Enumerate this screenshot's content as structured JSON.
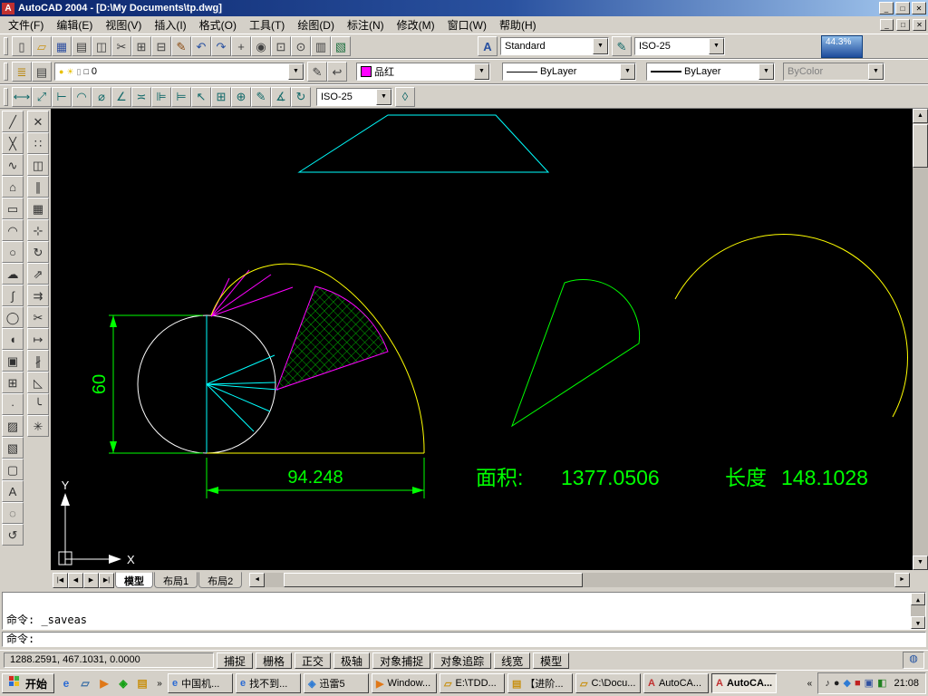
{
  "title_bar": {
    "icon": "A",
    "title": "AutoCAD 2004 - [D:\\My Documents\\tp.dwg]",
    "buttons": {
      "minimize": "_",
      "maximize": "□",
      "close": "✕"
    }
  },
  "menu_bar": {
    "items": [
      {
        "n": "menu-file",
        "label": "文件(F)"
      },
      {
        "n": "menu-edit",
        "label": "编辑(E)"
      },
      {
        "n": "menu-view",
        "label": "视图(V)"
      },
      {
        "n": "menu-insert",
        "label": "插入(I)"
      },
      {
        "n": "menu-format",
        "label": "格式(O)"
      },
      {
        "n": "menu-tools",
        "label": "工具(T)"
      },
      {
        "n": "menu-draw",
        "label": "绘图(D)"
      },
      {
        "n": "menu-dimension",
        "label": "标注(N)"
      },
      {
        "n": "menu-modify",
        "label": "修改(M)"
      },
      {
        "n": "menu-window",
        "label": "窗口(W)"
      },
      {
        "n": "menu-help",
        "label": "帮助(H)"
      }
    ],
    "mdi": {
      "minimize": "_",
      "restore": "□",
      "close": "✕"
    }
  },
  "toolbar_standard": {
    "icons": [
      {
        "n": "new-icon",
        "g": "▯",
        "c": "#404040"
      },
      {
        "n": "open-icon",
        "g": "▱",
        "c": "#C89010"
      },
      {
        "n": "save-icon",
        "g": "▦",
        "c": "#3050A0"
      },
      {
        "n": "plot-icon",
        "g": "▤",
        "c": "#404040"
      },
      {
        "n": "plot-preview-icon",
        "g": "◫",
        "c": "#404040"
      },
      {
        "n": "cut-icon",
        "g": "✂",
        "c": "#404040"
      },
      {
        "n": "copy-icon",
        "g": "⊞",
        "c": "#404040"
      },
      {
        "n": "paste-icon",
        "g": "⊟",
        "c": "#404040"
      },
      {
        "n": "match-properties-icon",
        "g": "✎",
        "c": "#8A4A10"
      },
      {
        "n": "undo-icon",
        "g": "↶",
        "c": "#2850A0"
      },
      {
        "n": "redo-icon",
        "g": "↷",
        "c": "#2850A0"
      },
      {
        "n": "pan-icon",
        "g": "+",
        "c": "#404040"
      },
      {
        "n": "zoom-realtime-icon",
        "g": "◉",
        "c": "#404040"
      },
      {
        "n": "zoom-window-icon",
        "g": "⊡",
        "c": "#404040"
      },
      {
        "n": "zoom-previous-icon",
        "g": "⊙",
        "c": "#404040"
      },
      {
        "n": "properties-icon",
        "g": "▥",
        "c": "#404040"
      },
      {
        "n": "designcenter-icon",
        "g": "▧",
        "c": "#207040"
      }
    ],
    "text_style_icon": "A",
    "text_style": "Standard",
    "dim_style_icon": "✎",
    "dim_style": "ISO-25",
    "zoom_badge": "44.3%"
  },
  "toolbar_layers": {
    "manager_icon": "≣",
    "states_icon": "▤",
    "layer_icons": [
      {
        "n": "layer-on-icon",
        "g": "●",
        "c": "#E8C000"
      },
      {
        "n": "layer-freeze-icon",
        "g": "☀",
        "c": "#E8C000"
      },
      {
        "n": "layer-lock-icon",
        "g": "▯",
        "c": "#808080"
      },
      {
        "n": "layer-color-icon",
        "g": "□",
        "c": "#000000"
      }
    ],
    "current_layer": "0",
    "make_current_icon": "✎",
    "previous_icon": "↩",
    "color_value": "品红",
    "color_hex": "#FF00FF",
    "linetype_value": "ByLayer",
    "lineweight_value": "ByLayer",
    "plotstyle_value": "ByColor"
  },
  "toolbar_dimension": {
    "icons": [
      {
        "n": "linear-dimension-icon",
        "g": "⟷",
        "c": "#106868"
      },
      {
        "n": "aligned-dimension-icon",
        "g": "⤢",
        "c": "#106868"
      },
      {
        "n": "ordinate-dimension-icon",
        "g": "⊢",
        "c": "#106868"
      },
      {
        "n": "radius-dimension-icon",
        "g": "◠",
        "c": "#106868"
      },
      {
        "n": "diameter-dimension-icon",
        "g": "⌀",
        "c": "#106868"
      },
      {
        "n": "angular-dimension-icon",
        "g": "∠",
        "c": "#106868"
      },
      {
        "n": "quick-dimension-icon",
        "g": "≍",
        "c": "#106868"
      },
      {
        "n": "baseline-dimension-icon",
        "g": "⊫",
        "c": "#106868"
      },
      {
        "n": "continue-dimension-icon",
        "g": "⊨",
        "c": "#106868"
      },
      {
        "n": "quick-leader-icon",
        "g": "↖",
        "c": "#106868"
      },
      {
        "n": "tolerance-icon",
        "g": "⊞",
        "c": "#106868"
      },
      {
        "n": "center-mark-icon",
        "g": "⊕",
        "c": "#106868"
      },
      {
        "n": "dimension-edit-icon",
        "g": "✎",
        "c": "#106868"
      },
      {
        "n": "dimension-text-edit-icon",
        "g": "∡",
        "c": "#106868"
      },
      {
        "n": "dimension-update-icon",
        "g": "↻",
        "c": "#106868"
      }
    ],
    "dim_style": "ISO-25",
    "style_icon": "◊"
  },
  "toolbar_draw": {
    "icons": [
      {
        "n": "line-icon",
        "g": "╱",
        "c": "#303030"
      },
      {
        "n": "construction-line-icon",
        "g": "╳",
        "c": "#303030"
      },
      {
        "n": "polyline-icon",
        "g": "∿",
        "c": "#303030"
      },
      {
        "n": "polygon-icon",
        "g": "⌂",
        "c": "#303030"
      },
      {
        "n": "rectangle-icon",
        "g": "▭",
        "c": "#303030"
      },
      {
        "n": "arc-icon",
        "g": "◠",
        "c": "#303030"
      },
      {
        "n": "circle-icon",
        "g": "○",
        "c": "#303030"
      },
      {
        "n": "revision-cloud-icon",
        "g": "☁",
        "c": "#303030"
      },
      {
        "n": "spline-icon",
        "g": "∫",
        "c": "#303030"
      },
      {
        "n": "ellipse-icon",
        "g": "◯",
        "c": "#303030"
      },
      {
        "n": "ellipse-arc-icon",
        "g": "◖",
        "c": "#303030"
      },
      {
        "n": "insert-block-icon",
        "g": "▣",
        "c": "#303030"
      },
      {
        "n": "make-block-icon",
        "g": "⊞",
        "c": "#303030"
      },
      {
        "n": "point-icon",
        "g": "∙",
        "c": "#303030"
      },
      {
        "n": "hatch-icon",
        "g": "▨",
        "c": "#303030"
      },
      {
        "n": "gradient-icon",
        "g": "▧",
        "c": "#303030"
      },
      {
        "n": "region-icon",
        "g": "▢",
        "c": "#303030"
      },
      {
        "n": "multiline-text-icon",
        "g": "A",
        "c": "#303030"
      },
      {
        "n": "draw-extra-1-icon",
        "g": "◌",
        "c": "#303030"
      },
      {
        "n": "draw-extra-2-icon",
        "g": "↺",
        "c": "#303030"
      }
    ]
  },
  "toolbar_modify": {
    "icons": [
      {
        "n": "erase-icon",
        "g": "✕",
        "c": "#303030"
      },
      {
        "n": "copy-object-icon",
        "g": "∷",
        "c": "#303030"
      },
      {
        "n": "mirror-icon",
        "g": "◫",
        "c": "#303030"
      },
      {
        "n": "offset-icon",
        "g": "∥",
        "c": "#303030"
      },
      {
        "n": "array-icon",
        "g": "▦",
        "c": "#303030"
      },
      {
        "n": "move-icon",
        "g": "⊹",
        "c": "#303030"
      },
      {
        "n": "rotate-icon",
        "g": "↻",
        "c": "#303030"
      },
      {
        "n": "scale-icon",
        "g": "⇗",
        "c": "#303030"
      },
      {
        "n": "stretch-icon",
        "g": "⇉",
        "c": "#303030"
      },
      {
        "n": "trim-icon",
        "g": "✂",
        "c": "#303030"
      },
      {
        "n": "extend-icon",
        "g": "↦",
        "c": "#303030"
      },
      {
        "n": "break-icon",
        "g": "∦",
        "c": "#303030"
      },
      {
        "n": "chamfer-icon",
        "g": "◺",
        "c": "#303030"
      },
      {
        "n": "fillet-icon",
        "g": "╰",
        "c": "#303030"
      },
      {
        "n": "explode-icon",
        "g": "✳",
        "c": "#303030"
      }
    ]
  },
  "drawing": {
    "dim_vertical": "60",
    "dim_horizontal": "94.248",
    "area_label": "面积:",
    "area_value": "1377.0506",
    "length_label": "长度",
    "length_value": "148.1028",
    "axis_x": "X",
    "axis_y": "Y",
    "colors": {
      "dimension": "#00FF00",
      "outline": "#FFFF00",
      "construction": "#00FFFF",
      "fan": "#FF00FF",
      "hatch": "#00B000",
      "entity": "#FFFFFF"
    }
  },
  "tabs": {
    "items": [
      {
        "n": "tab-model",
        "label": "模型",
        "active": true
      },
      {
        "n": "tab-layout1",
        "label": "布局1"
      },
      {
        "n": "tab-layout2",
        "label": "布局2"
      }
    ]
  },
  "command": {
    "history": [
      {
        "line": "命令: _saveas"
      }
    ],
    "prompt": "命令:"
  },
  "status_bar": {
    "coords": "1288.2591, 467.1031, 0.0000",
    "toggles": [
      {
        "n": "toggle-snap",
        "label": "捕捉"
      },
      {
        "n": "toggle-grid",
        "label": "栅格"
      },
      {
        "n": "toggle-ortho",
        "label": "正交"
      },
      {
        "n": "toggle-polar",
        "label": "极轴"
      },
      {
        "n": "toggle-osnap",
        "label": "对象捕捉"
      },
      {
        "n": "toggle-otrack",
        "label": "对象追踪"
      },
      {
        "n": "toggle-lineweight",
        "label": "线宽"
      },
      {
        "n": "toggle-model",
        "label": "模型"
      }
    ]
  },
  "taskbar": {
    "start_label": "开始",
    "quick_launch": [
      {
        "n": "ie-icon",
        "g": "e",
        "c": "#2B6BD4"
      },
      {
        "n": "show-desktop-icon",
        "g": "▱",
        "c": "#3A6EA5"
      },
      {
        "n": "media-player-icon",
        "g": "▶",
        "c": "#E07818"
      },
      {
        "n": "messenger-icon",
        "g": "◈",
        "c": "#14A014"
      },
      {
        "n": "explorer-icon",
        "g": "▤",
        "c": "#C89010"
      }
    ],
    "tasks": [
      {
        "n": "task-browser-1",
        "g": "e",
        "c": "#2B6BD4",
        "label": "中国机..."
      },
      {
        "n": "task-browser-2",
        "g": "e",
        "c": "#2B6BD4",
        "label": "找不到..."
      },
      {
        "n": "task-thunder",
        "g": "◈",
        "c": "#2E7BD4",
        "label": "迅雷5"
      },
      {
        "n": "task-media-player",
        "g": "▶",
        "c": "#E07818",
        "label": "Window..."
      },
      {
        "n": "task-folder-1",
        "g": "▱",
        "c": "#C89010",
        "label": "E:\\TDD..."
      },
      {
        "n": "task-document",
        "g": "▤",
        "c": "#C89010",
        "label": "【进阶..."
      },
      {
        "n": "task-folder-2",
        "g": "▱",
        "c": "#C89010",
        "label": "C:\\Docu..."
      },
      {
        "n": "task-autocad-1",
        "g": "A",
        "c": "#C03030",
        "label": "AutoCA..."
      },
      {
        "n": "task-autocad-2",
        "g": "A",
        "c": "#C03030",
        "label": "AutoCA...",
        "pressed": true
      }
    ],
    "tray_icons": [
      {
        "n": "volume-icon",
        "g": "♪",
        "c": "#303030"
      },
      {
        "n": "qq-icon",
        "g": "●",
        "c": "#202020"
      },
      {
        "n": "thunder-tray-icon",
        "g": "◆",
        "c": "#2E7BD4"
      },
      {
        "n": "antivirus-icon",
        "g": "■",
        "c": "#C02020"
      },
      {
        "n": "ime-icon",
        "g": "▣",
        "c": "#3050A0"
      },
      {
        "n": "network-icon",
        "g": "◧",
        "c": "#208020"
      }
    ],
    "time": "21:08"
  },
  "ui": {
    "combo_arrow": "▼",
    "scroll_up": "▲",
    "scroll_down": "▼",
    "scroll_left": "◄",
    "scroll_right": "►",
    "tab_first": "|◀",
    "tab_prev": "◀",
    "tab_next": "▶",
    "tab_last": "▶|",
    "chevron_left": "«",
    "chevron_right": "»",
    "comm_icon": "◍"
  }
}
